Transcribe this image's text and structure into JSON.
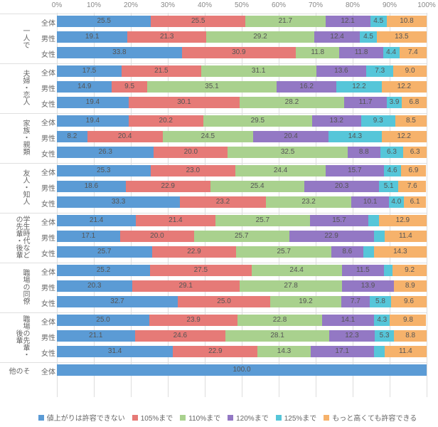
{
  "chart_data": {
    "type": "bar",
    "stacked": true,
    "orientation": "horizontal",
    "xlim": [
      0,
      100
    ],
    "x_ticks": [
      "0%",
      "10%",
      "20%",
      "30%",
      "40%",
      "50%",
      "60%",
      "70%",
      "80%",
      "90%",
      "100%"
    ],
    "series_names": [
      "値上がりは許容できない",
      "105%まで",
      "110%まで",
      "120%まで",
      "125%まで",
      "もっと高くても許容できる"
    ],
    "colors": [
      "#5b9bd5",
      "#e67a77",
      "#a9d18e",
      "#9378c4",
      "#56c6d9",
      "#f6b26b"
    ],
    "groups": [
      {
        "name": "一人で",
        "rows": [
          {
            "label": "全体",
            "values": [
              25.5,
              25.5,
              21.7,
              12.1,
              4.5,
              10.8
            ]
          },
          {
            "label": "男性",
            "values": [
              19.1,
              21.3,
              29.2,
              12.4,
              4.5,
              13.5
            ]
          },
          {
            "label": "女性",
            "values": [
              33.8,
              30.9,
              11.8,
              11.8,
              4.4,
              7.4
            ]
          }
        ]
      },
      {
        "name": "夫婦・恋人",
        "rows": [
          {
            "label": "全体",
            "values": [
              17.5,
              21.5,
              31.1,
              13.6,
              7.3,
              9.0
            ]
          },
          {
            "label": "男性",
            "values": [
              14.9,
              9.5,
              35.1,
              16.2,
              12.2,
              12.2
            ]
          },
          {
            "label": "女性",
            "values": [
              19.4,
              30.1,
              28.2,
              11.7,
              3.9,
              6.8
            ]
          }
        ]
      },
      {
        "name": "家族・親類",
        "rows": [
          {
            "label": "全体",
            "values": [
              19.4,
              20.2,
              29.5,
              13.2,
              9.3,
              8.5
            ]
          },
          {
            "label": "男性",
            "values": [
              8.2,
              20.4,
              24.5,
              20.4,
              14.3,
              12.2
            ]
          },
          {
            "label": "女性",
            "values": [
              26.3,
              20.0,
              32.5,
              8.8,
              6.3,
              6.3
            ]
          }
        ]
      },
      {
        "name": "友人・知人",
        "rows": [
          {
            "label": "全体",
            "values": [
              25.3,
              23.0,
              24.4,
              15.7,
              4.6,
              6.9
            ]
          },
          {
            "label": "男性",
            "values": [
              18.6,
              22.9,
              25.4,
              20.3,
              5.1,
              7.6
            ]
          },
          {
            "label": "女性",
            "values": [
              33.3,
              23.2,
              23.2,
              10.1,
              4.0,
              6.1
            ]
          }
        ]
      },
      {
        "name": "学生時代などの先輩・後輩",
        "rows": [
          {
            "label": "全体",
            "values": [
              21.4,
              21.4,
              25.7,
              15.7,
              2.9,
              12.9
            ]
          },
          {
            "label": "男性",
            "values": [
              17.1,
              20.0,
              25.7,
              22.9,
              2.9,
              11.4
            ]
          },
          {
            "label": "女性",
            "values": [
              25.7,
              22.9,
              25.7,
              8.6,
              2.9,
              14.3
            ]
          }
        ]
      },
      {
        "name": "職場の同僚",
        "rows": [
          {
            "label": "全体",
            "values": [
              25.2,
              27.5,
              24.4,
              11.5,
              2.3,
              9.2
            ]
          },
          {
            "label": "男性",
            "values": [
              20.3,
              29.1,
              27.8,
              13.9,
              0.0,
              8.9
            ]
          },
          {
            "label": "女性",
            "values": [
              32.7,
              25.0,
              19.2,
              7.7,
              5.8,
              9.6
            ]
          }
        ]
      },
      {
        "name": "職場の先輩・後輩",
        "rows": [
          {
            "label": "全体",
            "values": [
              25.0,
              23.9,
              22.8,
              14.1,
              4.3,
              9.8
            ]
          },
          {
            "label": "男性",
            "values": [
              21.1,
              24.6,
              28.1,
              12.3,
              5.3,
              8.8
            ]
          },
          {
            "label": "女性",
            "values": [
              31.4,
              22.9,
              14.3,
              17.1,
              2.9,
              11.4
            ]
          }
        ]
      },
      {
        "name": "その他",
        "rows": [
          {
            "label": "全体",
            "values": [
              100.0,
              0,
              0,
              0,
              0,
              0
            ]
          }
        ]
      }
    ]
  }
}
